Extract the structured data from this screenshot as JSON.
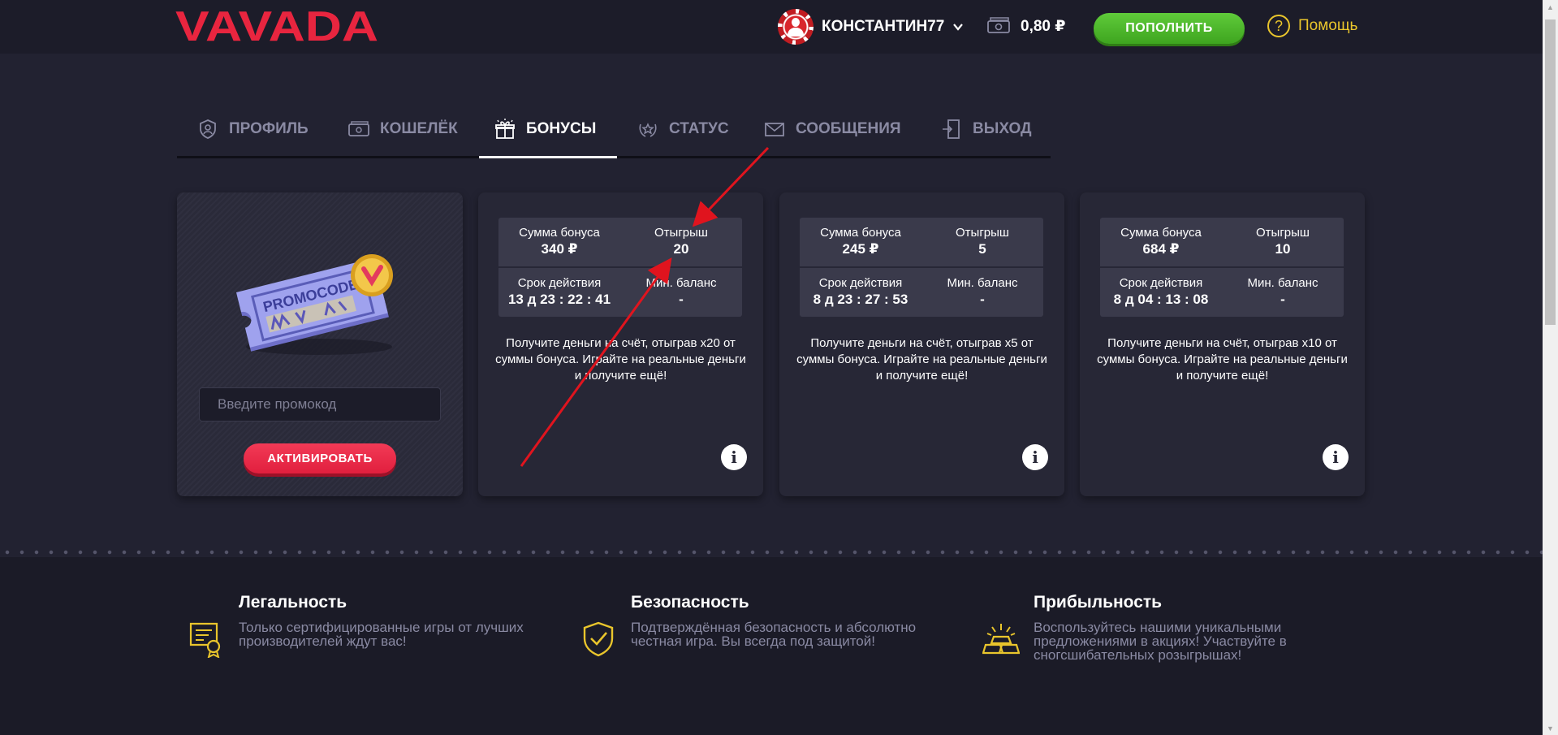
{
  "header": {
    "logo_text": "VAVADA",
    "username": "КОНСТАНТИН77",
    "balance": "0,80 ₽",
    "deposit_label": "ПОПОЛНИТЬ",
    "help_label": "Помощь"
  },
  "tabs": [
    {
      "label": "ПРОФИЛЬ",
      "icon": "shield-user-icon",
      "active": false
    },
    {
      "label": "КОШЕЛЁК",
      "icon": "wallet-icon",
      "active": false
    },
    {
      "label": "БОНУСЫ",
      "icon": "gift-icon",
      "active": true
    },
    {
      "label": "СТАТУС",
      "icon": "laurel-star-icon",
      "active": false
    },
    {
      "label": "СООБЩЕНИЯ",
      "icon": "envelope-icon",
      "active": false
    },
    {
      "label": "ВЫХОД",
      "icon": "exit-door-icon",
      "active": false
    }
  ],
  "promo": {
    "image_text": "PROMOCODE",
    "input_placeholder": "Введите промокод",
    "activate_label": "АКТИВИРОВАТЬ"
  },
  "bonus_labels": {
    "amount": "Сумма бонуса",
    "wager": "Отыгрыш",
    "validity": "Срок действия",
    "min_balance": "Мин. баланс"
  },
  "bonuses": [
    {
      "amount": "340 ₽",
      "wager": "20",
      "validity": "13 д 23 : 22 : 41",
      "min_balance": "-",
      "description": "Получите деньги на счёт, отыграв x20 от суммы бонуса. Играйте на реальные деньги и получите ещё!"
    },
    {
      "amount": "245 ₽",
      "wager": "5",
      "validity": "8 д 23 : 27 : 53",
      "min_balance": "-",
      "description": "Получите деньги на счёт, отыграв x5 от суммы бонуса. Играйте на реальные деньги и получите ещё!"
    },
    {
      "amount": "684 ₽",
      "wager": "10",
      "validity": "8 д 04 : 13 : 08",
      "min_balance": "-",
      "description": "Получите деньги на счёт, отыграв x10 от суммы бонуса. Играйте на реальные деньги и получите ещё!"
    }
  ],
  "info_glyph": "i",
  "features": [
    {
      "title": "Легальность",
      "text": "Только сертифицированные игры от лучших производителей ждут вас!",
      "icon": "certificate-icon"
    },
    {
      "title": "Безопасность",
      "text": "Подтверждённая безопасность и абсолютно честная игра. Вы всегда под защитой!",
      "icon": "shield-check-icon"
    },
    {
      "title": "Прибыльность",
      "text": "Воспользуйтесь нашими уникальными предложениями в акциях! Участвуйте в сногсшибательных розыгрышах!",
      "icon": "gold-bars-icon"
    }
  ],
  "colors": {
    "brand_red": "#e8253f",
    "deposit_green": "#4cb82a",
    "help_yellow": "#e9c52c",
    "background": "#222231",
    "annotation_arrow": "#e0141e"
  }
}
